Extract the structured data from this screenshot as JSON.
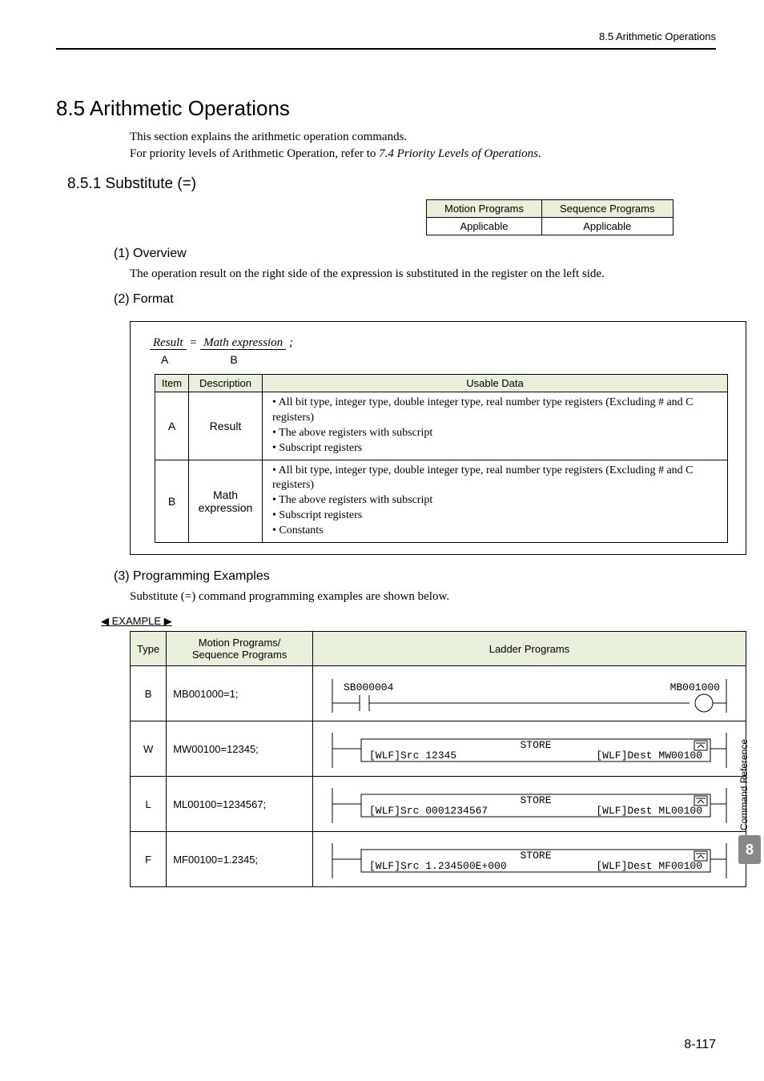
{
  "header": {
    "breadcrumb": "8.5  Arithmetic Operations"
  },
  "section": {
    "title": "8.5  Arithmetic Operations",
    "intro1": "This section explains the arithmetic operation commands.",
    "intro2a": "For priority levels of Arithmetic Operation, refer to ",
    "intro2b": "7.4 Priority Levels of Operations",
    "intro2c": "."
  },
  "sub": {
    "title": "8.5.1  Substitute (=)"
  },
  "applic": {
    "h1": "Motion Programs",
    "h2": "Sequence Programs",
    "v1": "Applicable",
    "v2": "Applicable"
  },
  "overview": {
    "title": "(1) Overview",
    "text": "The operation result on the right side of the expression is substituted in the register on the left side."
  },
  "format": {
    "title": "(2) Format",
    "formula_a": "Result",
    "formula_eq": "  =  ",
    "formula_b": "Math expression",
    "formula_end": " ;",
    "label_a": "A",
    "label_b": "B",
    "head_item": "Item",
    "head_desc": "Description",
    "head_usable": "Usable Data",
    "rows": [
      {
        "item": "A",
        "desc": "Result",
        "usable": [
          "All bit type, integer type, double integer type, real number type registers (Excluding # and C registers)",
          "The above registers with subscript",
          "Subscript registers"
        ]
      },
      {
        "item": "B",
        "desc": "Math expression",
        "usable": [
          "All bit type, integer type, double integer type, real number type registers (Excluding # and C registers)",
          "The above registers with subscript",
          "Subscript registers",
          "Constants"
        ]
      }
    ]
  },
  "examples": {
    "title": "(3) Programming Examples",
    "intro": "Substitute (=) command programming examples are shown below.",
    "marker_left": "◀",
    "marker_text": "EXAMPLE",
    "marker_right": "▶",
    "head_type": "Type",
    "head_prog": "Motion Programs/\nSequence Programs",
    "head_ladder": "Ladder Programs",
    "rows": [
      {
        "type": "B",
        "prog": "MB001000=1;",
        "ladder": {
          "kind": "contact",
          "left": "SB000004",
          "right": "MB001000"
        }
      },
      {
        "type": "W",
        "prog": "MW00100=12345;",
        "ladder": {
          "kind": "store",
          "src": "[WLF]Src 12345",
          "dest": "[WLF]Dest MW00100"
        }
      },
      {
        "type": "L",
        "prog": "ML00100=1234567;",
        "ladder": {
          "kind": "store",
          "src": "[WLF]Src 0001234567",
          "dest": "[WLF]Dest ML00100"
        }
      },
      {
        "type": "F",
        "prog": "MF00100=1.2345;",
        "ladder": {
          "kind": "store",
          "src": "[WLF]Src 1.234500E+000",
          "dest": "[WLF]Dest MF00100"
        }
      }
    ]
  },
  "side": {
    "label": "Command Reference",
    "chapter": "8"
  },
  "pagenum": "8-117",
  "ladder_common": {
    "store_label": "STORE",
    "icon_name": "collapse-icon"
  }
}
